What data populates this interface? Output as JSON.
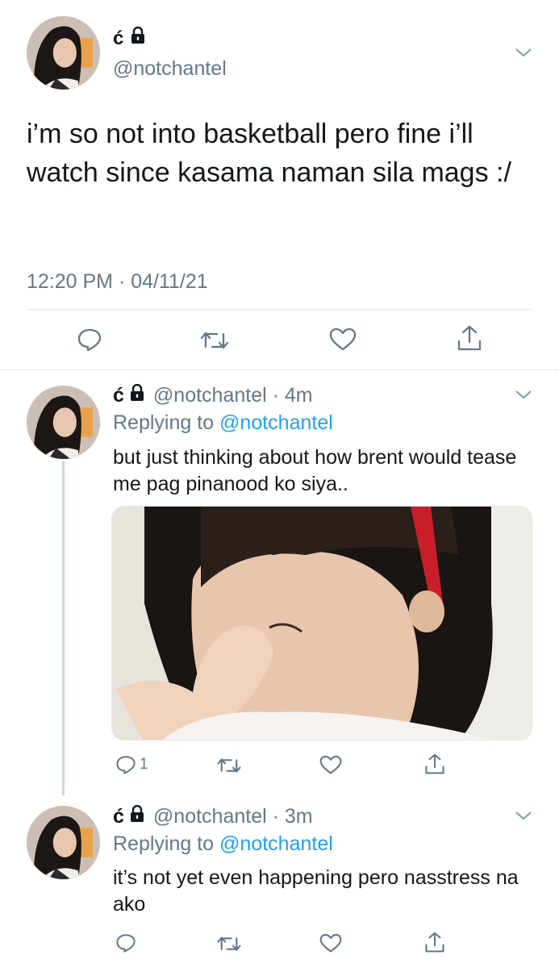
{
  "main_tweet": {
    "display_name": "ć",
    "handle": "@notchantel",
    "text": "i’m so not into basketball pero fine i’ll watch since kasama naman sila mags :/",
    "timestamp": "12:20 PM · 04/11/21"
  },
  "replies": [
    {
      "display_name": "ć",
      "meta": "@notchantel · 4m",
      "replying_prefix": "Replying to ",
      "replying_to": "@notchantel",
      "text": "but just thinking about how brent would tease me pag pinanood ko siya..",
      "reply_count": "1"
    },
    {
      "display_name": "ć",
      "meta": "@notchantel · 3m",
      "replying_prefix": "Replying to ",
      "replying_to": "@notchantel",
      "text": "it’s not yet even happening pero nasstress na ako",
      "reply_count": ""
    }
  ],
  "colors": {
    "text": "#14171a",
    "secondary": "#657786",
    "link": "#1da1f2",
    "divider": "#e1e8ed"
  },
  "icons": [
    "lock-icon",
    "chevron-down-icon",
    "reply-icon",
    "retweet-icon",
    "like-icon",
    "share-icon"
  ]
}
